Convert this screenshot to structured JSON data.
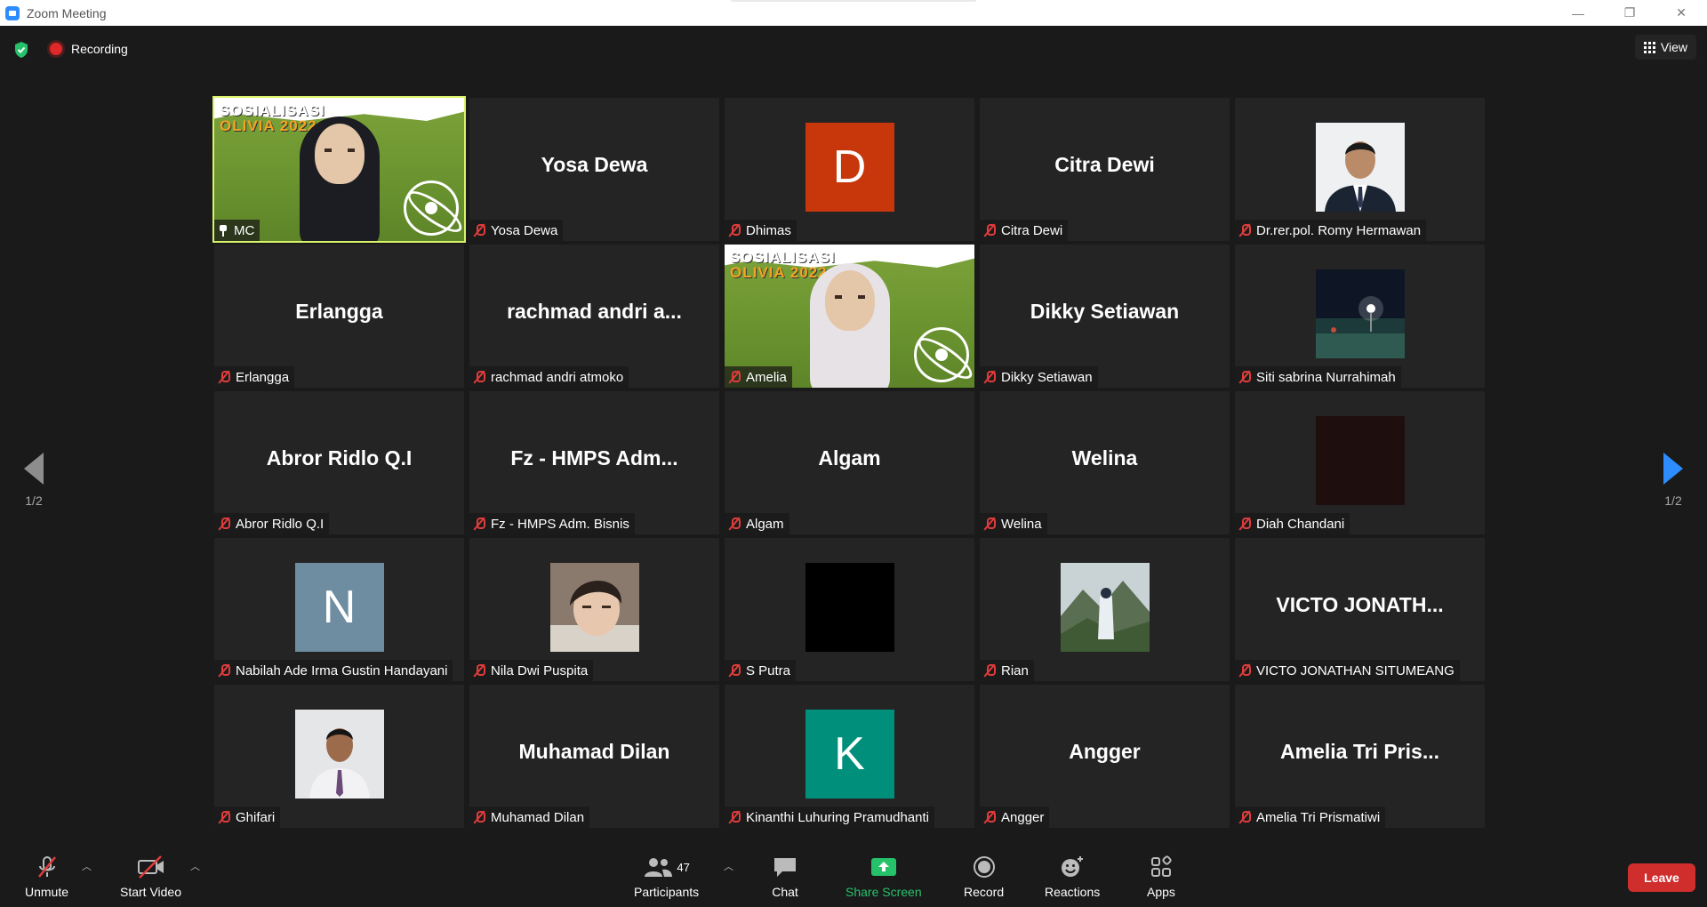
{
  "window": {
    "title": "Zoom Meeting",
    "minimize": "—",
    "restore": "❐",
    "close": "✕"
  },
  "topbar": {
    "recording_label": "Recording",
    "view_label": "View"
  },
  "nav": {
    "left_page": "1/2",
    "right_page": "1/2"
  },
  "tiles": [
    {
      "label": "MC",
      "display": "",
      "kind": "video-dark-hijab"
    },
    {
      "label": "Yosa Dewa",
      "display": "Yosa Dewa",
      "kind": "name"
    },
    {
      "label": "Dhimas",
      "display": "D",
      "kind": "letter",
      "color": "#c7370b"
    },
    {
      "label": "Citra Dewi",
      "display": "Citra Dewi",
      "kind": "name"
    },
    {
      "label": "Dr.rer.pol. Romy Hermawan",
      "display": "",
      "kind": "photo-suit"
    },
    {
      "label": "Erlangga",
      "display": "Erlangga",
      "kind": "name"
    },
    {
      "label": "rachmad andri atmoko",
      "display": "rachmad andri a...",
      "kind": "name"
    },
    {
      "label": "Amelia",
      "display": "",
      "kind": "video-light-hijab"
    },
    {
      "label": "Dikky Setiawan",
      "display": "Dikky Setiawan",
      "kind": "name"
    },
    {
      "label": "Siti sabrina Nurrahimah",
      "display": "",
      "kind": "photo-night"
    },
    {
      "label": "Abror Ridlo Q.I",
      "display": "Abror Ridlo Q.I",
      "kind": "name"
    },
    {
      "label": "Fz - HMPS Adm. Bisnis",
      "display": "Fz - HMPS Adm...",
      "kind": "name"
    },
    {
      "label": "Algam",
      "display": "Algam",
      "kind": "name"
    },
    {
      "label": "Welina",
      "display": "Welina",
      "kind": "name"
    },
    {
      "label": "Diah Chandani",
      "display": "",
      "kind": "photo-dark"
    },
    {
      "label": "Nabilah Ade Irma Gustin Handayani",
      "display": "N",
      "kind": "letter",
      "color": "#6f8da0"
    },
    {
      "label": "Nila Dwi Puspita",
      "display": "",
      "kind": "photo-face"
    },
    {
      "label": "S Putra",
      "display": "",
      "kind": "photo-black"
    },
    {
      "label": "Rian",
      "display": "",
      "kind": "photo-mountain"
    },
    {
      "label": "VICTO JONATHAN SITUMEANG",
      "display": "VICTO JONATH...",
      "kind": "name"
    },
    {
      "label": "Ghifari",
      "display": "",
      "kind": "photo-shirt"
    },
    {
      "label": "Muhamad Dilan",
      "display": "Muhamad Dilan",
      "kind": "name"
    },
    {
      "label": "Kinanthi Luhuring Pramudhanti",
      "display": "K",
      "kind": "letter",
      "color": "#008f7a"
    },
    {
      "label": "Angger",
      "display": "Angger",
      "kind": "name"
    },
    {
      "label": "Amelia Tri Prismatiwi",
      "display": "Amelia Tri Pris...",
      "kind": "name"
    }
  ],
  "video_overlay": {
    "line1": "SOSIALISASI",
    "line2": "OLIVIA 2022"
  },
  "toolbar": {
    "unmute": "Unmute",
    "start_video": "Start Video",
    "participants": "Participants",
    "participant_count": "47",
    "chat": "Chat",
    "share_screen": "Share Screen",
    "record": "Record",
    "reactions": "Reactions",
    "apps": "Apps",
    "leave": "Leave"
  },
  "colors": {
    "active_speaker": "#d9f36a",
    "share_green": "#25c26a",
    "leave_red": "#d02d2d",
    "muted_red": "#e03c3c"
  }
}
